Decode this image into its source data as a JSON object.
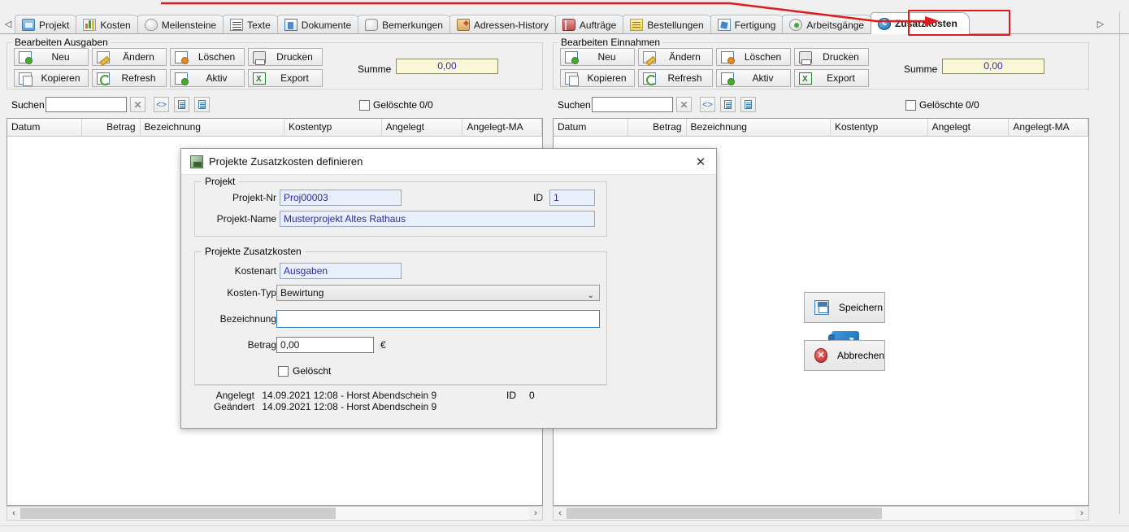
{
  "tabs": [
    {
      "label": "Projekt",
      "icon": "folder-icon",
      "active": false
    },
    {
      "label": "Kosten",
      "icon": "bar-chart-icon",
      "active": false
    },
    {
      "label": "Meilensteine",
      "icon": "stone-icon",
      "active": false
    },
    {
      "label": "Texte",
      "icon": "text-lines-icon",
      "active": false
    },
    {
      "label": "Dokumente",
      "icon": "document-icon",
      "active": false
    },
    {
      "label": "Bemerkungen",
      "icon": "comment-icon",
      "active": false
    },
    {
      "label": "Adressen-History",
      "icon": "brush-icon",
      "active": false
    },
    {
      "label": "Aufträge",
      "icon": "book-icon",
      "active": false
    },
    {
      "label": "Bestellungen",
      "icon": "note-icon",
      "active": false
    },
    {
      "label": "Fertigung",
      "icon": "blue-square-icon",
      "active": false
    },
    {
      "label": "Arbeitsgänge",
      "icon": "green-dot-icon",
      "active": false
    },
    {
      "label": "Zusatzkosten",
      "icon": "euro-circle-icon",
      "active": true
    }
  ],
  "tab_nav": {
    "left": "◁",
    "right": "▷"
  },
  "panels": [
    {
      "title": "Bearbeiten Ausgaben",
      "buttons": [
        {
          "label": "Neu",
          "icon": "new-icon"
        },
        {
          "label": "Ändern",
          "icon": "edit-icon"
        },
        {
          "label": "Löschen",
          "icon": "delete-icon"
        },
        {
          "label": "Drucken",
          "icon": "print-icon"
        },
        {
          "label": "Kopieren",
          "icon": "copy-icon"
        },
        {
          "label": "Refresh",
          "icon": "refresh-icon"
        },
        {
          "label": "Aktiv",
          "icon": "active-icon"
        },
        {
          "label": "Export",
          "icon": "excel-icon"
        }
      ],
      "sum_label": "Summe",
      "sum_value": "0,00",
      "search_label": "Suchen",
      "search_value": "",
      "deleted_label": "Gelöschte",
      "deleted_count": "0/0",
      "columns": [
        "Datum",
        "Betrag",
        "Bezeichnung",
        "Kostentyp",
        "Angelegt",
        "Angelegt-MA"
      ],
      "rows": []
    },
    {
      "title": "Bearbeiten Einnahmen",
      "buttons": [
        {
          "label": "Neu",
          "icon": "new-icon"
        },
        {
          "label": "Ändern",
          "icon": "edit-icon"
        },
        {
          "label": "Löschen",
          "icon": "delete-icon"
        },
        {
          "label": "Drucken",
          "icon": "print-icon"
        },
        {
          "label": "Kopieren",
          "icon": "copy-icon"
        },
        {
          "label": "Refresh",
          "icon": "refresh-icon"
        },
        {
          "label": "Aktiv",
          "icon": "active-icon"
        },
        {
          "label": "Export",
          "icon": "excel-icon"
        }
      ],
      "sum_label": "Summe",
      "sum_value": "0,00",
      "search_label": "Suchen",
      "search_value": "",
      "deleted_label": "Gelöschte",
      "deleted_count": "0/0",
      "columns": [
        "Datum",
        "Betrag",
        "Bezeichnung",
        "Kostentyp",
        "Angelegt",
        "Angelegt-MA"
      ],
      "rows": []
    }
  ],
  "dialog": {
    "title": "Projekte Zusatzkosten definieren",
    "close_label": "✕",
    "projekt_group": {
      "title": "Projekt",
      "nr_label": "Projekt-Nr",
      "nr_value": "Proj00003",
      "id_label": "ID",
      "id_value": "1",
      "name_label": "Projekt-Name",
      "name_value": "Musterprojekt Altes Rathaus"
    },
    "zusatz_group": {
      "title": "Projekte Zusatzkosten",
      "kostenart_label": "Kostenart",
      "kostenart_value": "Ausgaben",
      "kostentyp_label": "Kosten-Typ",
      "kostentyp_value": "Bewirtung",
      "bezeichnung_label": "Bezeichnung",
      "bezeichnung_value": "",
      "betrag_label": "Betrag",
      "betrag_value": "0,00",
      "currency": "€",
      "geloescht_label": "Gelöscht"
    },
    "buttons": {
      "save_label": "Speichern",
      "cancel_label": "Abbrechen"
    },
    "audit": {
      "created_label": "Angelegt",
      "created_value": "14.09.2021 12:08 - Horst Abendschein 9",
      "changed_label": "Geändert",
      "changed_value": "14.09.2021 12:08 - Horst Abendschein 9",
      "id_label": "ID",
      "id_value": "0"
    }
  },
  "colors": {
    "accent": "#2f7fc4",
    "annotation": "#e01b1b",
    "sum_field_bg": "#fbf8d8",
    "readonly_field_bg": "#eaf0fb",
    "readonly_text": "#2a2aa8"
  }
}
